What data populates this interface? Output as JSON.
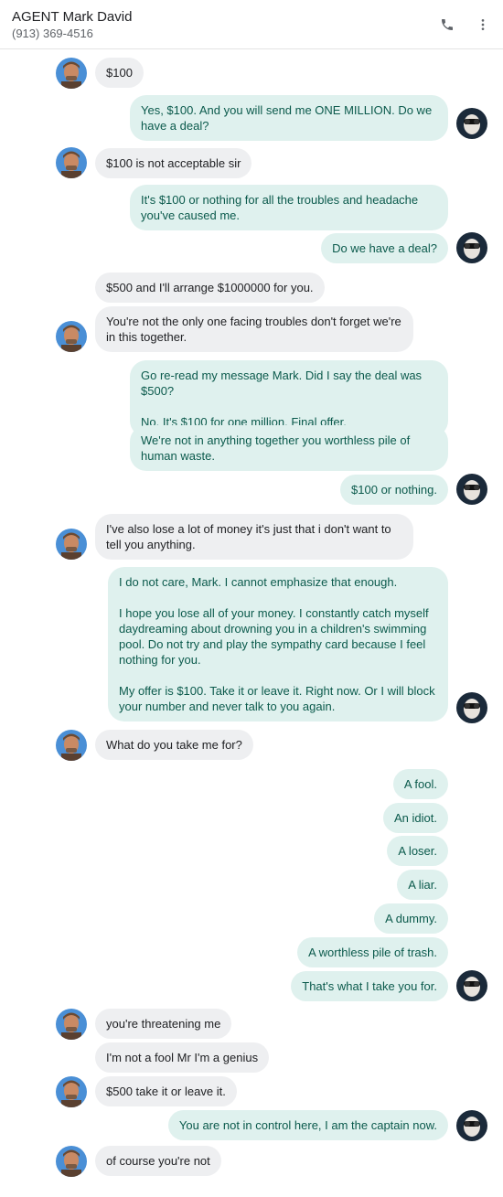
{
  "header": {
    "name": "AGENT Mark David",
    "phone": "(913) 369-4516",
    "call_icon": "phone-icon",
    "menu_icon": "more-vert-icon"
  },
  "colors": {
    "incoming_bubble": "#eeeff1",
    "outgoing_bubble": "#dff1ee",
    "outgoing_text": "#0b5a4c"
  },
  "messages": [
    {
      "dir": "in",
      "text": "$100"
    },
    {
      "dir": "out",
      "text": "Yes, $100. And you will send me ONE MILLION. Do we have a deal?"
    },
    {
      "dir": "in",
      "text": "$100 is not acceptable sir"
    },
    {
      "dir": "out",
      "text": "It's $100 or nothing for all the troubles and headache you've caused me."
    },
    {
      "dir": "out",
      "text": "Do we have a deal?"
    },
    {
      "dir": "in",
      "text": "$500 and I'll arrange $1000000 for you."
    },
    {
      "dir": "in",
      "text": "You're not the only one facing troubles don't forget we're in this together."
    },
    {
      "dir": "out",
      "text": "Go re-read my message Mark. Did I say the deal was $500?\n\nNo. It's $100 for one million. Final offer."
    },
    {
      "dir": "out",
      "text": "We're not in anything together you worthless pile of human waste."
    },
    {
      "dir": "out",
      "text": "$100 or nothing."
    },
    {
      "dir": "in",
      "text": "I've also lose a lot of money it's just that i don't want to tell you anything."
    },
    {
      "dir": "out",
      "text": "I do not care, Mark. I cannot emphasize that enough.\n\nI hope you lose all of your money. I constantly catch myself daydreaming about drowning you in a children's swimming pool. Do not try and play the sympathy card because I feel nothing for you.\n\nMy offer is $100. Take it or leave it. Right now. Or I will block your number and never talk to you again."
    },
    {
      "dir": "in",
      "text": "What do you take me for?"
    },
    {
      "dir": "out",
      "text": "A fool."
    },
    {
      "dir": "out",
      "text": "An idiot."
    },
    {
      "dir": "out",
      "text": "A loser."
    },
    {
      "dir": "out",
      "text": "A liar."
    },
    {
      "dir": "out",
      "text": "A dummy."
    },
    {
      "dir": "out",
      "text": "A worthless pile of trash."
    },
    {
      "dir": "out",
      "text": "That's what I take you for."
    },
    {
      "dir": "in",
      "text": "you're threatening me"
    },
    {
      "dir": "in",
      "text": "I'm not a fool Mr I'm a genius"
    },
    {
      "dir": "in",
      "text": "$500 take it or leave it."
    },
    {
      "dir": "out",
      "text": "You are not in control here, I am the captain now."
    },
    {
      "dir": "in",
      "text": "of course you're not"
    }
  ]
}
